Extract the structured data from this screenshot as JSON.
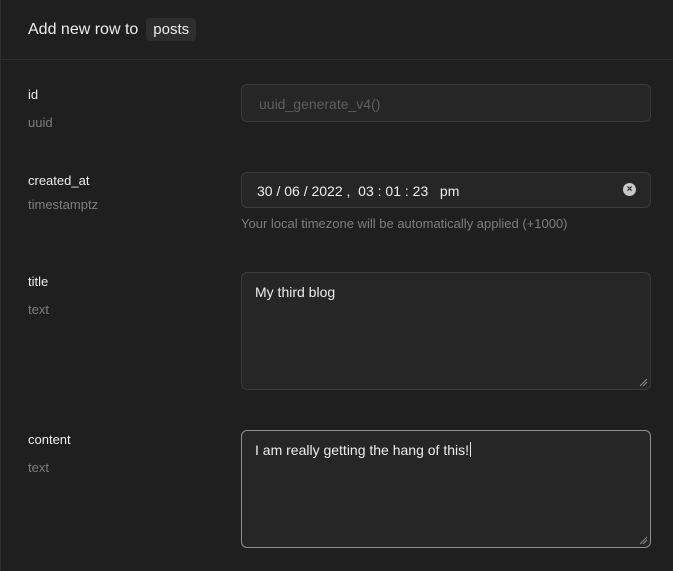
{
  "header": {
    "title": "Add new row to",
    "table_name": "posts"
  },
  "fields": [
    {
      "name": "id",
      "type": "uuid",
      "placeholder": "uuid_generate_v4()"
    },
    {
      "name": "created_at",
      "type": "timestamptz",
      "value": "30 / 06 / 2022 ,  03 : 01 : 23   pm",
      "help": "Your local timezone will be automatically applied (+1000)"
    },
    {
      "name": "title",
      "type": "text",
      "value": "My third blog"
    },
    {
      "name": "content",
      "type": "text",
      "value": "I am really getting the hang of this!"
    }
  ],
  "icons": {
    "clear": "clear-icon",
    "resize": "resize-handle-icon"
  }
}
